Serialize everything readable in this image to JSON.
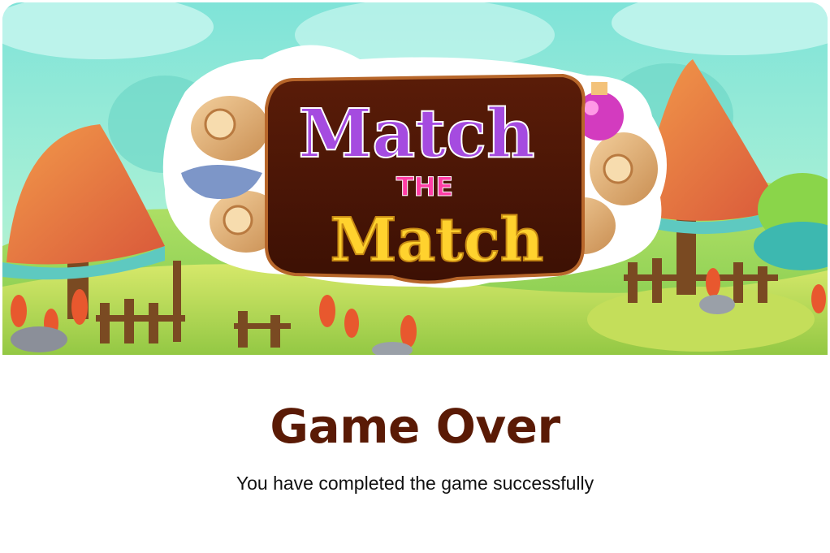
{
  "banner": {
    "logo_word_top": "Match",
    "logo_word_mid": "THE",
    "logo_word_bottom": "Match"
  },
  "dialog": {
    "title": "Game Over",
    "message": "You have completed the game successfully"
  },
  "colors": {
    "title": "#5a1a05",
    "logo_top": "#a54be0",
    "logo_mid": "#ff3ea5",
    "logo_bottom": "#ffd22e",
    "sign_board": "#4a1606"
  }
}
